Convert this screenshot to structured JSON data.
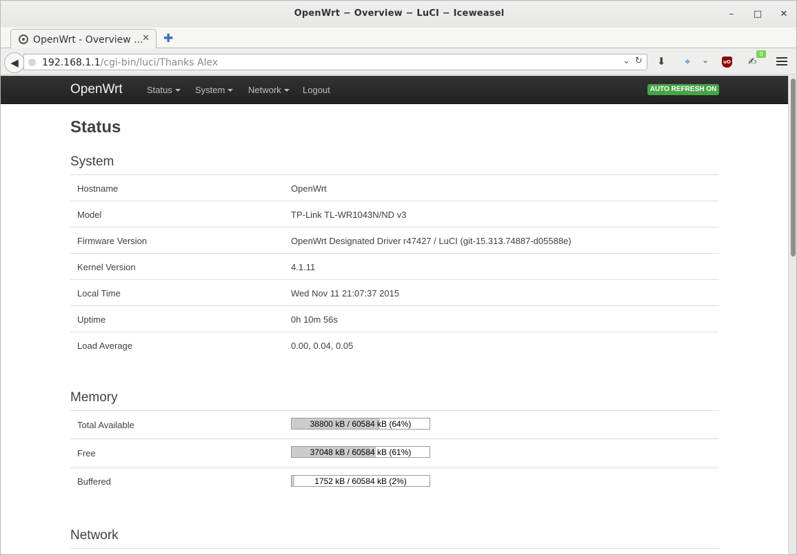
{
  "window": {
    "title": "OpenWrt − Overview − LuCI − Iceweasel",
    "minimize": "–",
    "maximize": "□",
    "close": "✕"
  },
  "tab": {
    "title": "OpenWrt - Overview ...",
    "close": "✕",
    "new": "✚"
  },
  "address": {
    "host": "192.168.1.1",
    "path": "/cgi-bin/luci/Thanks Alex",
    "dropdown": "⌄",
    "reload": "↻"
  },
  "toolbar": {
    "download": "⬇",
    "addon_icon": "⌖",
    "addon_dropdown": "⌄",
    "ublock_label": "uO",
    "badge": "0"
  },
  "luci": {
    "brand": "OpenWrt",
    "menu": [
      {
        "label": "Status"
      },
      {
        "label": "System"
      },
      {
        "label": "Network"
      },
      {
        "label": "Logout"
      }
    ],
    "auto_refresh": "AUTO REFRESH ON"
  },
  "page": {
    "title": "Status",
    "system": {
      "heading": "System",
      "rows": [
        {
          "key": "Hostname",
          "value": "OpenWrt"
        },
        {
          "key": "Model",
          "value": "TP-Link TL-WR1043N/ND v3"
        },
        {
          "key": "Firmware Version",
          "value": "OpenWrt Designated Driver r47427 / LuCI (git-15.313.74887-d05588e)"
        },
        {
          "key": "Kernel Version",
          "value": "4.1.11"
        },
        {
          "key": "Local Time",
          "value": "Wed Nov 11 21:07:37 2015"
        },
        {
          "key": "Uptime",
          "value": "0h 10m 56s"
        },
        {
          "key": "Load Average",
          "value": "0.00, 0.04, 0.05"
        }
      ]
    },
    "memory": {
      "heading": "Memory",
      "rows": [
        {
          "key": "Total Available",
          "label": "38800 kB / 60584 kB (64%)",
          "fraction": 0.64
        },
        {
          "key": "Free",
          "label": "37048 kB / 60584 kB (61%)",
          "fraction": 0.61
        },
        {
          "key": "Buffered",
          "label": "1752 kB / 60584 kB (2%)",
          "fraction": 0.02
        }
      ]
    },
    "network": {
      "heading": "Network"
    }
  }
}
